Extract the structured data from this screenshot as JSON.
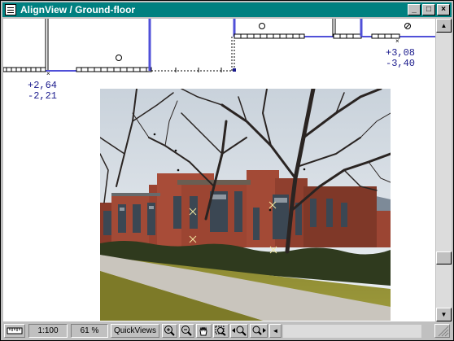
{
  "window": {
    "title": "AlignView / Ground-floor",
    "minimize": "_",
    "maximize": "□",
    "close": "×"
  },
  "readouts": {
    "left_x": "+2,64",
    "left_y": "-2,21",
    "right_x": "+3,08",
    "right_y": "-3,40"
  },
  "statusbar": {
    "scale": "1:100",
    "zoom": "61 %",
    "quickviews": "QuickViews"
  },
  "icons": {
    "ruler": "ruler-icon",
    "zoom_in": "zoom-in-icon",
    "zoom_out": "zoom-out-icon",
    "pan": "hand-pan-icon",
    "fit": "fit-zoom-icon",
    "prev": "zoom-previous-icon",
    "next": "zoom-next-icon",
    "scroll_left": "scroll-left-icon",
    "scroll_up": "scroll-up-icon",
    "scroll_down": "scroll-down-icon",
    "resize": "resize-grip-icon"
  },
  "colors": {
    "titlebar": "#008080",
    "plan_lines": "#5050d8",
    "readout_text": "#1a1a8c"
  }
}
